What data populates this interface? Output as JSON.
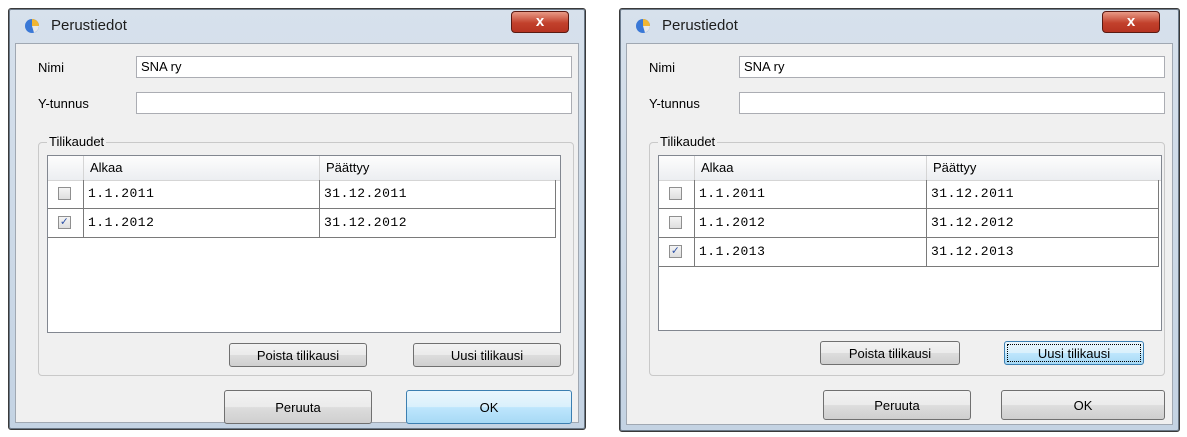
{
  "dialogs": [
    {
      "title": "Perustiedot",
      "close_glyph": "x",
      "name_label": "Nimi",
      "name_value": "SNA ry",
      "id_label": "Y-tunnus",
      "id_value": "",
      "group_title": "Tilikaudet",
      "columns": [
        "Alkaa",
        "Päättyy"
      ],
      "rows": [
        {
          "checked": false,
          "start": "1.1.2011",
          "end": "31.12.2011"
        },
        {
          "checked": true,
          "start": "1.1.2012",
          "end": "31.12.2012"
        }
      ],
      "delete_button": "Poista tilikausi",
      "new_button": "Uusi tilikausi",
      "cancel_button": "Peruuta",
      "ok_button": "OK"
    },
    {
      "title": "Perustiedot",
      "close_glyph": "x",
      "name_label": "Nimi",
      "name_value": "SNA ry",
      "id_label": "Y-tunnus",
      "id_value": "",
      "group_title": "Tilikaudet",
      "columns": [
        "Alkaa",
        "Päättyy"
      ],
      "rows": [
        {
          "checked": false,
          "start": "1.1.2011",
          "end": "31.12.2011"
        },
        {
          "checked": false,
          "start": "1.1.2012",
          "end": "31.12.2012"
        },
        {
          "checked": true,
          "start": "1.1.2013",
          "end": "31.12.2013"
        }
      ],
      "delete_button": "Poista tilikausi",
      "new_button": "Uusi tilikausi",
      "cancel_button": "Peruuta",
      "ok_button": "OK"
    }
  ],
  "icons": {
    "app": "perustiedot-app-icon",
    "check": "checkmark-icon"
  },
  "colors": {
    "close_button": "#c2412c",
    "default_button": "#bee6fd",
    "check": "#2a4fa5"
  }
}
